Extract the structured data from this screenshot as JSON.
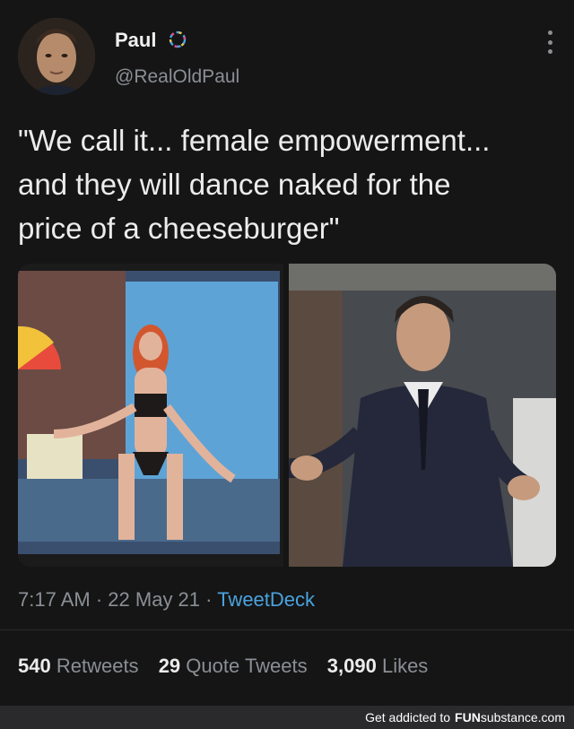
{
  "user": {
    "display_name": "Paul",
    "handle": "@RealOldPaul",
    "avatar_icon": "profile-photo",
    "badge_icon": "verified-badge-icon"
  },
  "tweet": {
    "text": "\"We call it... female empowerment...\nand they will dance naked for the\nprice of a cheeseburger\"",
    "time": "7:17 AM",
    "date": "22 May 21",
    "source": "TweetDeck"
  },
  "media": {
    "left_image": "stream-screenshot",
    "right_image": "man-in-suit"
  },
  "stats": {
    "retweets_count": "540",
    "retweets_label": "Retweets",
    "quotes_count": "29",
    "quotes_label": "Quote Tweets",
    "likes_count": "3,090",
    "likes_label": "Likes"
  },
  "footer": {
    "prefix": "Get addicted to",
    "brand_bold": "FUN",
    "brand_rest": "substance.com"
  }
}
